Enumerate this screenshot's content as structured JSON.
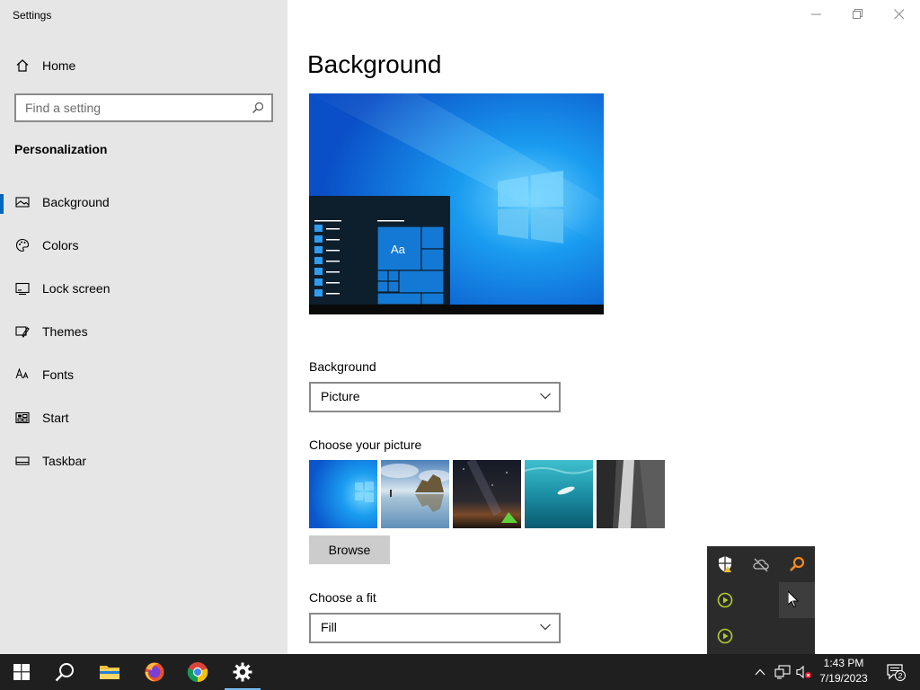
{
  "window": {
    "title": "Settings",
    "controls": {
      "minimize": "minimize",
      "restore": "restore",
      "close": "close"
    }
  },
  "sidebar": {
    "home_label": "Home",
    "search_placeholder": "Find a setting",
    "section_title": "Personalization",
    "items": [
      {
        "label": "Background",
        "icon": "picture-icon",
        "active": true
      },
      {
        "label": "Colors",
        "icon": "palette-icon",
        "active": false
      },
      {
        "label": "Lock screen",
        "icon": "lock-screen-icon",
        "active": false
      },
      {
        "label": "Themes",
        "icon": "themes-icon",
        "active": false
      },
      {
        "label": "Fonts",
        "icon": "fonts-icon",
        "active": false
      },
      {
        "label": "Start",
        "icon": "start-icon",
        "active": false
      },
      {
        "label": "Taskbar",
        "icon": "taskbar-icon",
        "active": false
      }
    ]
  },
  "main": {
    "title": "Background",
    "preview": {
      "sample_text": "Aa"
    },
    "background_label": "Background",
    "background_value": "Picture",
    "choose_picture_label": "Choose your picture",
    "pictures": [
      "windows-light",
      "beach-rocks",
      "night-sky-tent",
      "underwater-swimmer",
      "waterfall-cliff"
    ],
    "browse_label": "Browse",
    "fit_label": "Choose a fit",
    "fit_value": "Fill"
  },
  "tray_flyout": {
    "icons": [
      "security-warning-icon",
      "cloud-off-icon",
      "search-tool-icon",
      "media-play-icon",
      "empty-slot",
      "media-play-icon"
    ]
  },
  "taskbar": {
    "buttons": [
      "start-button",
      "search-button",
      "file-explorer",
      "firefox",
      "chrome",
      "settings"
    ],
    "time": "1:43 PM",
    "date": "7/19/2023",
    "notification_count": "2"
  },
  "colors": {
    "accent": "#0067c0",
    "sidebar_bg": "#e6e6e6",
    "taskbar_bg": "#1f1f1f"
  }
}
